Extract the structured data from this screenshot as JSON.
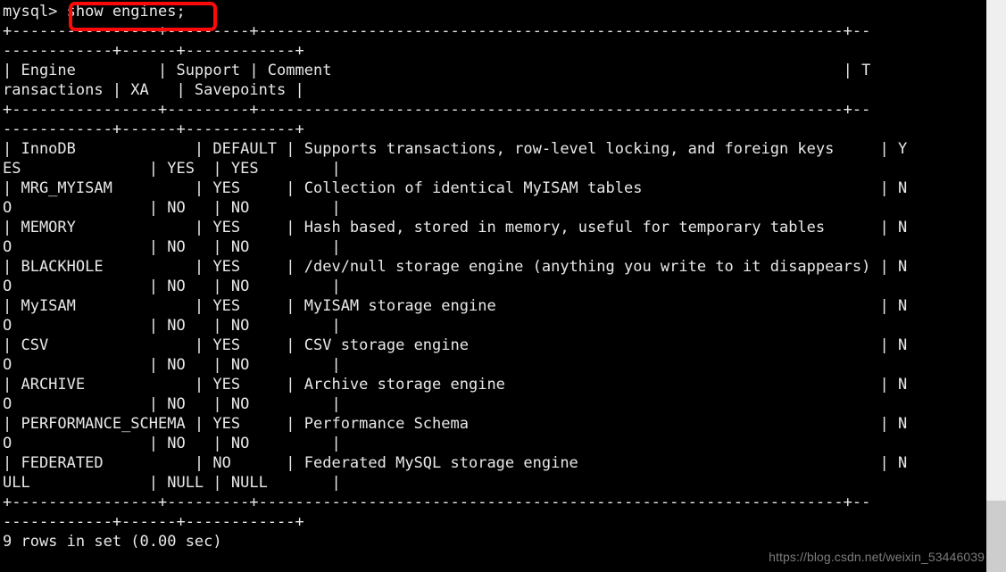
{
  "terminal": {
    "prompt": "mysql>",
    "command": "show engines;",
    "prompt_line": "mysql> show engines;",
    "result_status": "9 rows in set (0.00 sec)",
    "row_count": 9,
    "elapsed": "0.00 sec",
    "colors": {
      "background": "#000000",
      "foreground": "#e8e8e8",
      "highlight_box": "#fb0a09",
      "page_gutter": "#efefef",
      "scrollbar": "#cdcdcd",
      "watermark_text": "#7c7c7c"
    },
    "wrap_columns": 99,
    "separator_segment_a": "+----------------+---------+----------------------------------------------------------------+--",
    "separator_segment_b": "------------+------+------------+",
    "wrapped_lines": [
      "+----------------+---------+----------------------------------------------------------------+--",
      "------------+------+------------+",
      "| Engine         | Support | Comment                                                        | T",
      "ransactions | XA   | Savepoints |",
      "+----------------+---------+----------------------------------------------------------------+--",
      "------------+------+------------+",
      "| InnoDB             | DEFAULT | Supports transactions, row-level locking, and foreign keys     | Y",
      "ES              | YES  | YES        |",
      "| MRG_MYISAM         | YES     | Collection of identical MyISAM tables                          | N",
      "O               | NO   | NO         |",
      "| MEMORY             | YES     | Hash based, stored in memory, useful for temporary tables      | N",
      "O               | NO   | NO         |",
      "| BLACKHOLE          | YES     | /dev/null storage engine (anything you write to it disappears) | N",
      "O               | NO   | NO         |",
      "| MyISAM             | YES     | MyISAM storage engine                                          | N",
      "O               | NO   | NO         |",
      "| CSV                | YES     | CSV storage engine                                             | N",
      "O               | NO   | NO         |",
      "| ARCHIVE            | YES     | Archive storage engine                                         | N",
      "O               | NO   | NO         |",
      "| PERFORMANCE_SCHEMA | YES     | Performance Schema                                             | N",
      "O               | NO   | NO         |",
      "| FEDERATED          | NO      | Federated MySQL storage engine                                 | N",
      "ULL             | NULL | NULL       |",
      "+----------------+---------+----------------------------------------------------------------+--",
      "------------+------+------------+",
      "9 rows in set (0.00 sec)"
    ],
    "table": {
      "headers": [
        "Engine",
        "Support",
        "Comment",
        "Transactions",
        "XA",
        "Savepoints"
      ],
      "rows": [
        {
          "engine": "InnoDB",
          "support": "DEFAULT",
          "comment": "Supports transactions, row-level locking, and foreign keys",
          "transactions": "YES",
          "xa": "YES",
          "savepoints": "YES"
        },
        {
          "engine": "MRG_MYISAM",
          "support": "YES",
          "comment": "Collection of identical MyISAM tables",
          "transactions": "NO",
          "xa": "NO",
          "savepoints": "NO"
        },
        {
          "engine": "MEMORY",
          "support": "YES",
          "comment": "Hash based, stored in memory, useful for temporary tables",
          "transactions": "NO",
          "xa": "NO",
          "savepoints": "NO"
        },
        {
          "engine": "BLACKHOLE",
          "support": "YES",
          "comment": "/dev/null storage engine (anything you write to it disappears)",
          "transactions": "NO",
          "xa": "NO",
          "savepoints": "NO"
        },
        {
          "engine": "MyISAM",
          "support": "YES",
          "comment": "MyISAM storage engine",
          "transactions": "NO",
          "xa": "NO",
          "savepoints": "NO"
        },
        {
          "engine": "CSV",
          "support": "YES",
          "comment": "CSV storage engine",
          "transactions": "NO",
          "xa": "NO",
          "savepoints": "NO"
        },
        {
          "engine": "ARCHIVE",
          "support": "YES",
          "comment": "Archive storage engine",
          "transactions": "NO",
          "xa": "NO",
          "savepoints": "NO"
        },
        {
          "engine": "PERFORMANCE_SCHEMA",
          "support": "YES",
          "comment": "Performance Schema",
          "transactions": "NO",
          "xa": "NO",
          "savepoints": "NO"
        },
        {
          "engine": "FEDERATED",
          "support": "NO",
          "comment": "Federated MySQL storage engine",
          "transactions": "NULL",
          "xa": "NULL",
          "savepoints": "NULL"
        }
      ]
    }
  },
  "watermark": {
    "text": "https://blog.csdn.net/weixin_53446039"
  }
}
